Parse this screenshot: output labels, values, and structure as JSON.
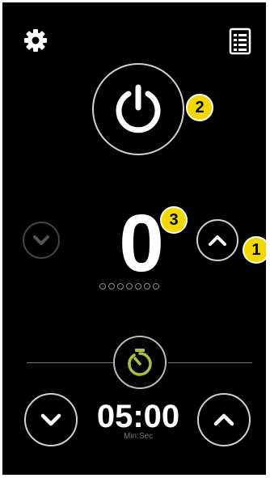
{
  "icons": {
    "settings": "gear-icon",
    "menu": "list-icon",
    "power": "power-icon",
    "timer": "timer-icon",
    "chevron_up": "chevron-up-icon",
    "chevron_down": "chevron-down-icon"
  },
  "level": {
    "value": "0",
    "indicator_count": 7,
    "level_filled": 0
  },
  "timer": {
    "value": "05:00",
    "unit_label": "Min:Sec"
  },
  "badges": {
    "b1": "1",
    "b2": "2",
    "b3": "3"
  },
  "colors": {
    "background": "#000000",
    "foreground": "#ffffff",
    "accent": "#a9c23f",
    "badge": "#f3d700",
    "disabled": "#555555"
  }
}
